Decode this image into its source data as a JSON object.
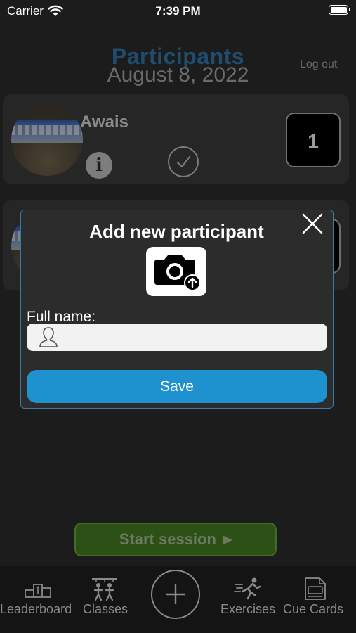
{
  "status_bar": {
    "carrier": "Carrier",
    "time": "7:39 PM"
  },
  "header": {
    "title": "Participants",
    "date": "August 8, 2022",
    "logout_label": "Log out"
  },
  "participants": [
    {
      "name": "Awais",
      "score": "1"
    }
  ],
  "modal": {
    "title": "Add new participant",
    "full_name_label": "Full name:",
    "full_name_value": "",
    "full_name_placeholder": "",
    "save_label": "Save"
  },
  "start_session": {
    "label": "Start session"
  },
  "tabbar": {
    "items": [
      {
        "label": "Leaderboard",
        "icon": "podium-icon"
      },
      {
        "label": "Classes",
        "icon": "classes-icon"
      },
      {
        "label": "",
        "icon": "plus-icon"
      },
      {
        "label": "Exercises",
        "icon": "runner-icon"
      },
      {
        "label": "Cue Cards",
        "icon": "cue-card-icon"
      }
    ]
  },
  "colors": {
    "background": "#1c1c1c",
    "title": "#1f4d6e",
    "modal_border": "#3a78a8",
    "save_button": "#1e91cf",
    "start_button": "#2c5016"
  }
}
